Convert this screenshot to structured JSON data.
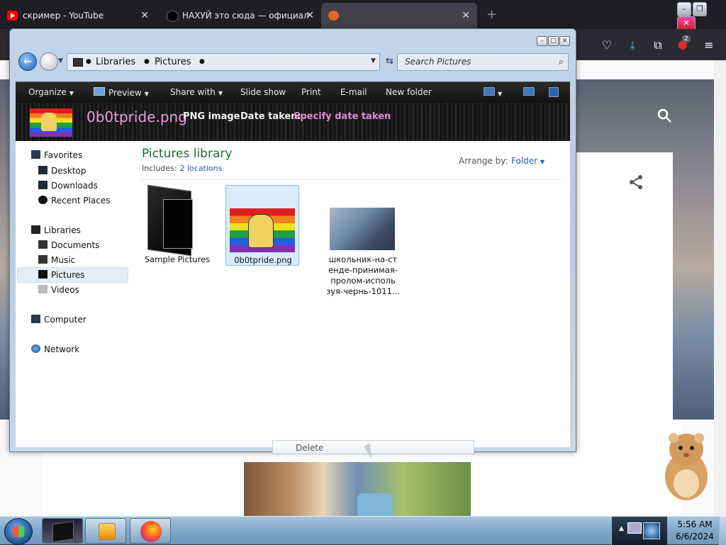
{
  "browser": {
    "tabs": [
      {
        "label": "скример - YouTube",
        "close": "✕"
      },
      {
        "label": "НАХУЙ это сюда — официал",
        "close": "✕"
      },
      {
        "label": "",
        "close": "✕"
      }
    ],
    "new_tab": "+",
    "extension_badge": "2"
  },
  "explorer": {
    "address": {
      "crumbs": [
        "Libraries",
        "Pictures"
      ]
    },
    "search_placeholder": "Search Pictures",
    "toolbar": {
      "organize": "Organize",
      "preview": "Preview",
      "share_with": "Share with",
      "slide_show": "Slide show",
      "print": "Print",
      "email": "E-mail",
      "new_folder": "New folder"
    },
    "details": {
      "name": "0b0tpride.png",
      "type": "PNG image",
      "date_label": "Date taken:",
      "date_value": "Specify date taken"
    },
    "nav": {
      "favorites": "Favorites",
      "desktop": "Desktop",
      "downloads": "Downloads",
      "recent": "Recent Places",
      "libraries": "Libraries",
      "documents": "Documents",
      "music": "Music",
      "pictures": "Pictures",
      "videos": "Videos",
      "computer": "Computer",
      "network": "Network"
    },
    "library": {
      "title": "Pictures library",
      "includes_label": "Includes:",
      "includes_link": "2 locations",
      "arrange_label": "Arrange by:",
      "arrange_value": "Folder"
    },
    "items": [
      {
        "label": "Sample Pictures"
      },
      {
        "label": "0b0tpride.png"
      },
      {
        "line1": "школьник-на-ст",
        "line2": "енде-принимая-",
        "line3": "пролом-исполь",
        "line4": "зуя-чернь-1011..."
      }
    ],
    "context_menu": {
      "delete": "Delete"
    }
  },
  "taskbar": {
    "time": "5:56 AM",
    "date": "6/6/2024"
  }
}
